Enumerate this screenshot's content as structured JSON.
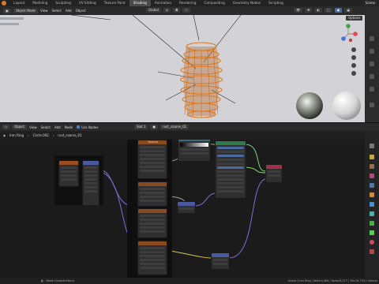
{
  "topbar": {
    "workspaces": [
      "Layout",
      "Modeling",
      "Sculpting",
      "UV Editing",
      "Texture Paint",
      "Shading",
      "Animation",
      "Rendering",
      "Compositing",
      "Geometry Nodes",
      "Scripting"
    ],
    "active_workspace": "Shading",
    "scene_label": "Scene"
  },
  "viewport": {
    "mode": "Object Mode",
    "menus": [
      "View",
      "Select",
      "Add",
      "Object"
    ],
    "transform": "Global",
    "options_label": "Options"
  },
  "node_editor": {
    "editor_type": "Object",
    "menus": [
      "View",
      "Select",
      "Add",
      "Node"
    ],
    "use_nodes_label": "Use Nodes",
    "slot": "Slot 1",
    "material": "rust_coarse_01",
    "breadcrumb": [
      "Iron Ring",
      "Circle.002",
      "rust_coarse_01"
    ],
    "texture_node_title": "Texture"
  },
  "status_bar": {
    "hint": "Node Context Menu",
    "stats": "Scene | Iron Ring | Verts:4,484 | Faces:8,377 | Tris:16,754 | Objects"
  },
  "colors": {
    "accent": "#e07b1b",
    "viewport_bg": "#d3d3d7",
    "editor_bg": "#1b1b1b",
    "link_purple": "#7b6fd6",
    "link_yellow": "#d7c64a",
    "link_green": "#7bd07b",
    "link_gray": "#9a9a9a"
  }
}
